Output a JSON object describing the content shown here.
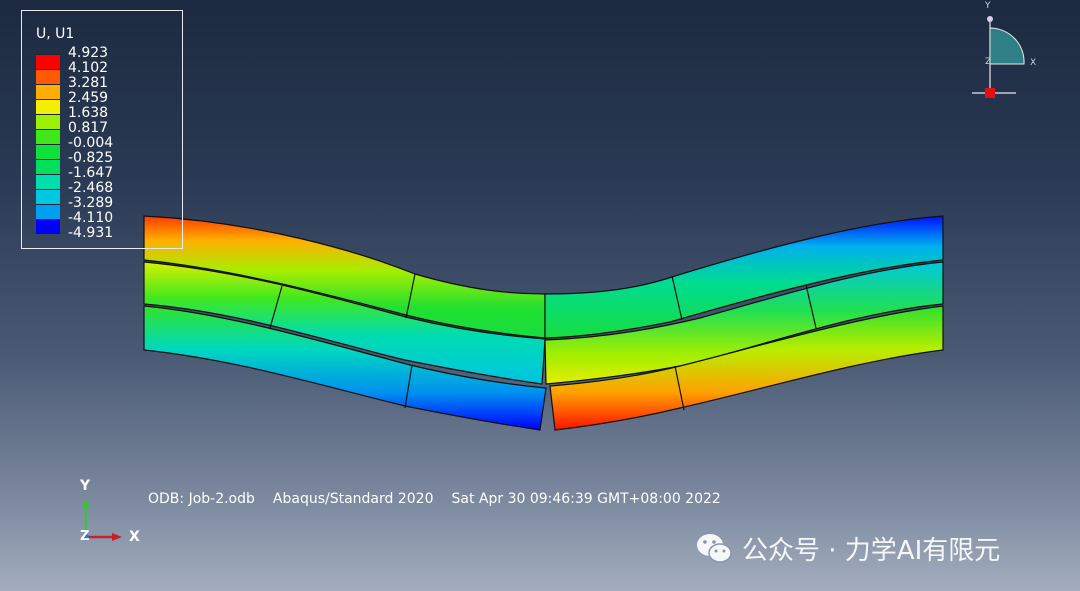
{
  "legend": {
    "title": "U, U1",
    "labels": [
      "4.923",
      "4.102",
      "3.281",
      "2.459",
      "1.638",
      "0.817",
      "-0.004",
      "-0.825",
      "-1.647",
      "-2.468",
      "-3.289",
      "-4.110",
      "-4.931"
    ],
    "colors": [
      "#ff0000",
      "#ff5a00",
      "#ffae00",
      "#f4ee00",
      "#9ef000",
      "#40e81a",
      "#10e03c",
      "#00e05a",
      "#00ddb0",
      "#00c8e0",
      "#00a0f0",
      "#0050f0",
      "#0000ff"
    ]
  },
  "info": {
    "odb": "ODB: Job-2.odb",
    "solver": "Abaqus/Standard 2020",
    "date": "Sat Apr 30 09:46:39 GMT+08:00 2022"
  },
  "triad": {
    "y": "Y",
    "z": "Z",
    "x": "X"
  },
  "view_cube": {
    "y": "Y",
    "z": "Z",
    "x": "X"
  },
  "watermark": {
    "text": "公众号 · 力学AI有限元",
    "icon": "wechat-icon"
  },
  "colors": {
    "x_axis": "#c8202a",
    "y_axis": "#3fbf3f",
    "z_axis": "#4060ff",
    "quadrant_fill": "#2f7f86"
  }
}
